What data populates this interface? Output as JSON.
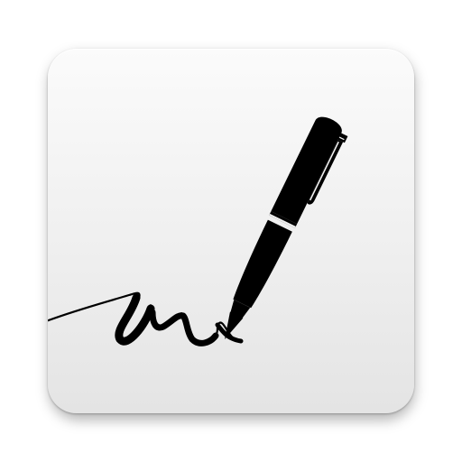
{
  "app_icon": {
    "name": "pen-signature-app-icon",
    "tile_gradient_top": "#fbfbfb",
    "tile_gradient_bottom": "#e4e4e4",
    "ink_color": "#000000",
    "pen_icon": "fountain-pen-icon",
    "stroke_icon": "signature-stroke-icon"
  }
}
